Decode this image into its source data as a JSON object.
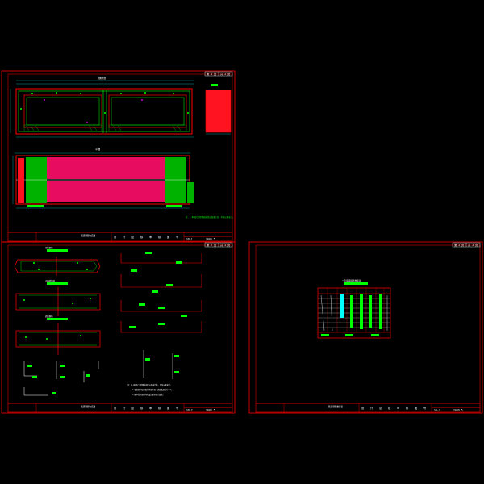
{
  "colors": {
    "background": "#000000",
    "frame": "#ff0000",
    "concrete": "#ff0000",
    "rebar": "#00ff00",
    "dimension": "#00ffff",
    "hatch": "#ff00ff",
    "text": "#ffffff",
    "highlight": "#00ffff"
  },
  "sheets": [
    {
      "id": "sheet-1",
      "page_tag": [
        "第 1 页",
        "共 3 页"
      ],
      "title_block": {
        "project": "箱涵钢筋构造图",
        "subtitle": "",
        "cells": [
          "设",
          "计",
          "复",
          "核",
          "审",
          "核",
          "图",
          "号"
        ],
        "drawing_no": "SD-1",
        "date": "2009.5"
      },
      "note": "注：1.本图尺寸除钢筋直径以毫米计外，余均以厘米计。",
      "views": [
        "横断面",
        "平面"
      ]
    },
    {
      "id": "sheet-2",
      "page_tag": [
        "第 2 页",
        "共 3 页"
      ],
      "title_block": {
        "project": "箱涵钢筋构造图",
        "subtitle": "",
        "cells": [
          "设",
          "计",
          "复",
          "核",
          "审",
          "核",
          "图",
          "号"
        ],
        "drawing_no": "SD-2",
        "date": "2009.5"
      },
      "notes": [
        "注：1.本图尺寸除钢筋直径以毫米计外，余均以厘米计。",
        "2.钢筋保护层厚度为净保护层，底板及顶板为4cm。",
        "3.图中所示钢筋均按设计要求进行绑扎。"
      ],
      "views": [
        "顶板钢筋",
        "中隔墙钢筋",
        "底板钢筋"
      ]
    },
    {
      "id": "sheet-3",
      "page_tag": [
        "第 3 页",
        "共 3 页"
      ],
      "title_block": {
        "project": "箱涵钢筋数量表",
        "subtitle": "",
        "cells": [
          "设",
          "计",
          "复",
          "核",
          "审",
          "核",
          "图",
          "号"
        ],
        "drawing_no": "SD-3",
        "date": "2009.5"
      },
      "table_title": "一孔箱涵钢筋数量表"
    }
  ]
}
